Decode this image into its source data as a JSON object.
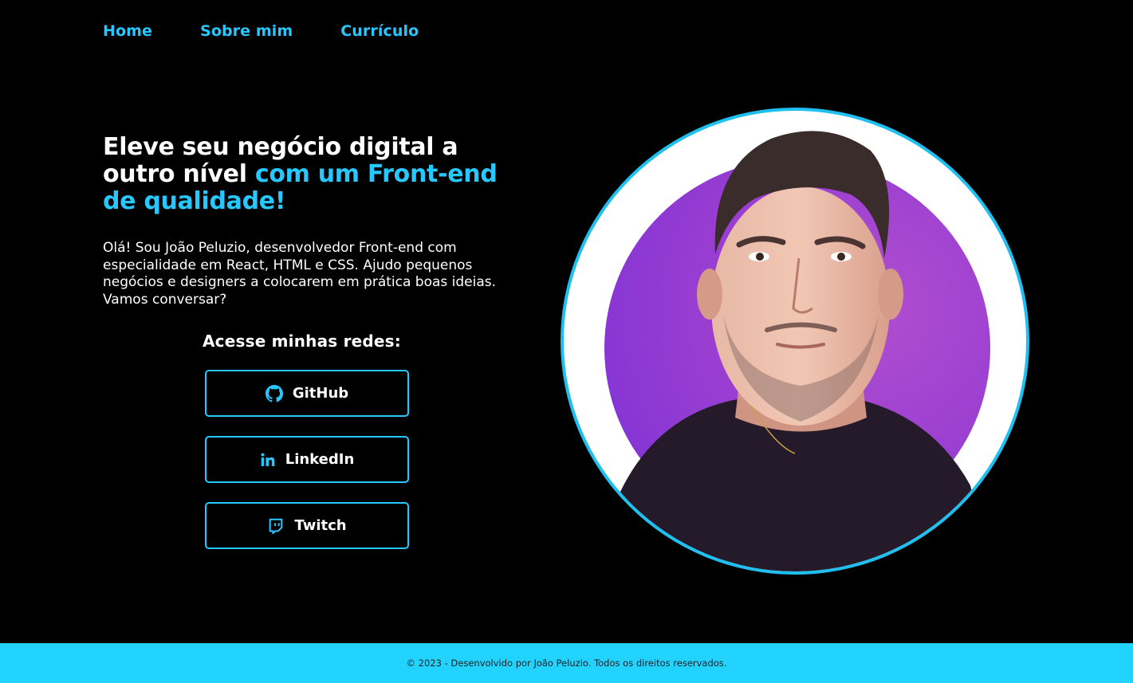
{
  "nav": {
    "items": [
      {
        "label": "Home"
      },
      {
        "label": "Sobre mim"
      },
      {
        "label": "Currículo"
      }
    ]
  },
  "hero": {
    "headline_part1": "Eleve seu negócio digital a outro nível ",
    "headline_accent": "com um Front-end de qualidade!",
    "intro": "Olá! Sou João Peluzio, desenvolvedor Front-end com especialidade em React, HTML e CSS. Ajudo pequenos negócios e designers a colocarem em prática boas ideias. Vamos conversar?",
    "social_title": "Acesse minhas redes:",
    "social": [
      {
        "label": "GitHub",
        "icon": "github-icon"
      },
      {
        "label": "LinkedIn",
        "icon": "linkedin-icon"
      },
      {
        "label": "Twitch",
        "icon": "twitch-icon"
      }
    ]
  },
  "footer": {
    "text": "© 2023 - Desenvolvido por João Peluzio. Todos os direitos reservados."
  },
  "colors": {
    "background": "#000000",
    "accent": "#27c8ff",
    "footer": "#22d3ff",
    "portrait_bg": "#9b3fd1"
  }
}
